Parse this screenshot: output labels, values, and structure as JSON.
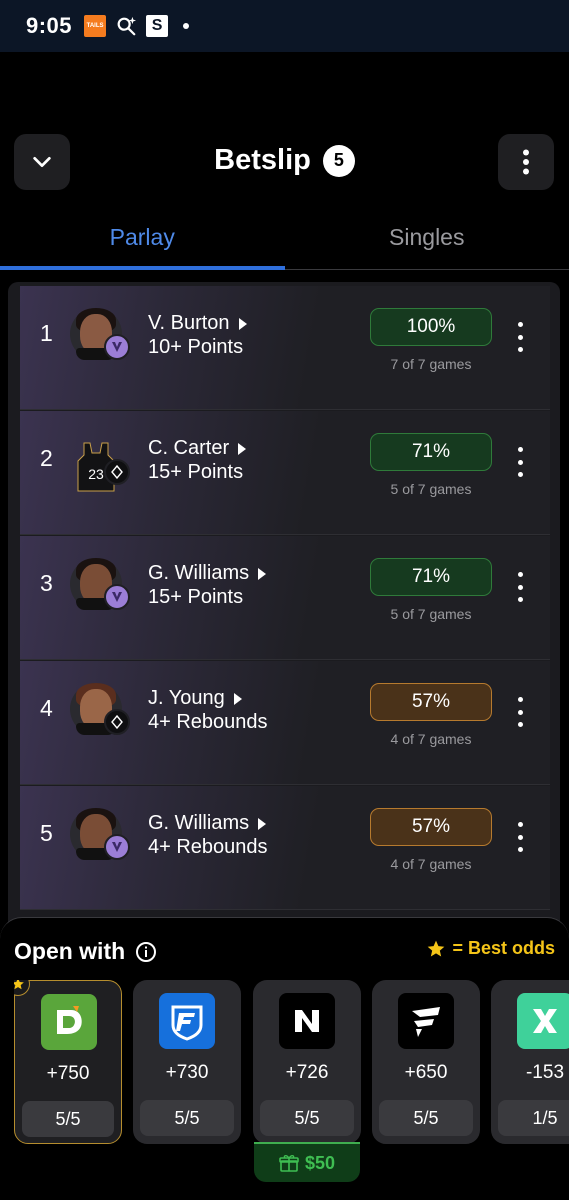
{
  "status_bar": {
    "time": "9:05",
    "tails_label": "TAILS",
    "s_label": "S"
  },
  "header": {
    "title": "Betslip",
    "count": "5"
  },
  "tabs": [
    {
      "label": "Parlay",
      "active": true
    },
    {
      "label": "Singles",
      "active": false
    }
  ],
  "legs": [
    {
      "num": "1",
      "player": "V. Burton",
      "stat": "10+ Points",
      "pct": "100%",
      "games": "7 of 7 games",
      "tier": "green",
      "team": "purple"
    },
    {
      "num": "2",
      "player": "C. Carter",
      "stat": "15+ Points",
      "pct": "71%",
      "games": "5 of 7 games",
      "tier": "green",
      "team": "dark",
      "jersey_number": "23"
    },
    {
      "num": "3",
      "player": "G. Williams",
      "stat": "15+ Points",
      "pct": "71%",
      "games": "5 of 7 games",
      "tier": "green",
      "team": "purple"
    },
    {
      "num": "4",
      "player": "J. Young",
      "stat": "4+ Rebounds",
      "pct": "57%",
      "games": "4 of 7 games",
      "tier": "amber",
      "team": "dark"
    },
    {
      "num": "5",
      "player": "G. Williams",
      "stat": "4+ Rebounds",
      "pct": "57%",
      "games": "4 of 7 games",
      "tier": "amber",
      "team": "purple"
    }
  ],
  "open_with": {
    "title": "Open with",
    "best_odds_label": "= Best odds",
    "books": [
      {
        "name": "DraftKings",
        "odds": "+750",
        "legs": "5/5",
        "best": true,
        "color": "#5aa63b"
      },
      {
        "name": "FanDuel",
        "odds": "+730",
        "legs": "5/5",
        "best": false,
        "color": "#1670dc"
      },
      {
        "name": "Novig",
        "odds": "+726",
        "legs": "5/5",
        "best": false,
        "color": "#000000"
      },
      {
        "name": "Fliff",
        "odds": "+650",
        "legs": "5/5",
        "best": false,
        "color": "#000000"
      },
      {
        "name": "ProphetX",
        "odds": "-153",
        "legs": "1/5",
        "best": false,
        "color": "#3fd19a"
      }
    ],
    "promo": "$50"
  }
}
